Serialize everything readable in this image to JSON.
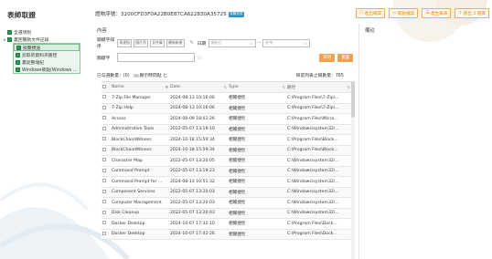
{
  "sidebar": {
    "title": "表師取證",
    "tree": [
      {
        "label": "全選項別",
        "level": 0,
        "caret": ""
      },
      {
        "label": "裏回簡款文件記錄",
        "level": 0,
        "caret": "▾"
      },
      {
        "label": "檢覽撲送",
        "level": 1
      },
      {
        "label": "剪取的資料夾路徑",
        "level": 1
      },
      {
        "label": "裏從整塊紀",
        "level": 1
      },
      {
        "label": "Windows筱點(Windows ...",
        "level": 1
      }
    ]
  },
  "header": {
    "record_label": "證物序號：3200CFD3F0A22B0E87CA622830A35725",
    "tag": "常顯資訊",
    "actions": [
      {
        "label": "進出檔案",
        "icon": "☐"
      },
      {
        "label": "開啟檔案",
        "icon": "▭"
      },
      {
        "label": "產生報表",
        "icon": "☰"
      },
      {
        "label": "匯出 3 選擇",
        "icon": "⇪"
      }
    ]
  },
  "content_label": "內容",
  "remark_label": "備註",
  "form": {
    "row1_label": "關鍵字排序",
    "tags": [
      "表達指",
      "圖片序",
      "文件庫",
      "最新新增"
    ],
    "date_label": "日期",
    "date_start_placeholder": "開始日",
    "date_sep": "~",
    "date_end_placeholder": "結束",
    "row2_label": "關鍵字",
    "keyword_placeholder": "",
    "search_btn": "新增",
    "reset_btn": "重置"
  },
  "counts": {
    "selected_label": "已勾選數量：(0)",
    "toggle_label": "顯示時間點 匕",
    "total_label": "目前列表之總數量：765"
  },
  "table": {
    "headers": [
      "Name",
      "Date",
      "Type",
      "路徑"
    ],
    "rows": [
      [
        "7-Zip File Manager",
        "2024-08-13 10:16:06",
        "相關捷徑",
        "C:\\Program Files\\7-Zip\\..."
      ],
      [
        "7-Zip Help",
        "2024-08-13 10:16:06",
        "相關捷徑",
        "C:\\Program Files\\7-Zip\\..."
      ],
      [
        "Access",
        "2024-08-09 18:02:26",
        "相關捷徑",
        "C:\\Program Files\\Micro..."
      ],
      [
        "Administrative Tools",
        "2022-05-07 13:19:10",
        "相關捷徑",
        "C:\\Windows\\system32\\..."
      ],
      [
        "BlockChainWitness",
        "2024-10-18 15:59:34",
        "相關捷徑",
        "C:\\Program Files\\Block..."
      ],
      [
        "BlockChainWitness",
        "2024-10-18 15:59:34",
        "相關捷徑",
        "C:\\Program Files\\Block..."
      ],
      [
        "Character Map",
        "2022-05-07 13:20:05",
        "相關捷徑",
        "C:\\Windows\\system32\\..."
      ],
      [
        "Command Prompt",
        "2022-05-07 13:19:23",
        "相關捷徑",
        "C:\\Windows\\system32\\..."
      ],
      [
        "Command Prompt for ...",
        "2024-08-13 10:51:32",
        "相關捷徑",
        "C:\\Windows\\system32\\..."
      ],
      [
        "Component Services",
        "2022-05-07 13:20:03",
        "相關捷徑",
        "C:\\Windows\\system32\\..."
      ],
      [
        "Computer Management",
        "2022-05-07 13:20:03",
        "相關捷徑",
        "C:\\Windows\\system32\\..."
      ],
      [
        "Disk Cleanup",
        "2022-05-07 13:20:03",
        "相關捷徑",
        "C:\\Windows\\system32\\..."
      ],
      [
        "Docker Desktop",
        "2024-10-07 17:32:10",
        "相關捷徑",
        "C:\\Program Files\\Dock..."
      ],
      [
        "Docker Desktop",
        "2024-10-07 17:42:26",
        "相關捷徑",
        "C:\\Program Files\\Dock..."
      ]
    ]
  }
}
